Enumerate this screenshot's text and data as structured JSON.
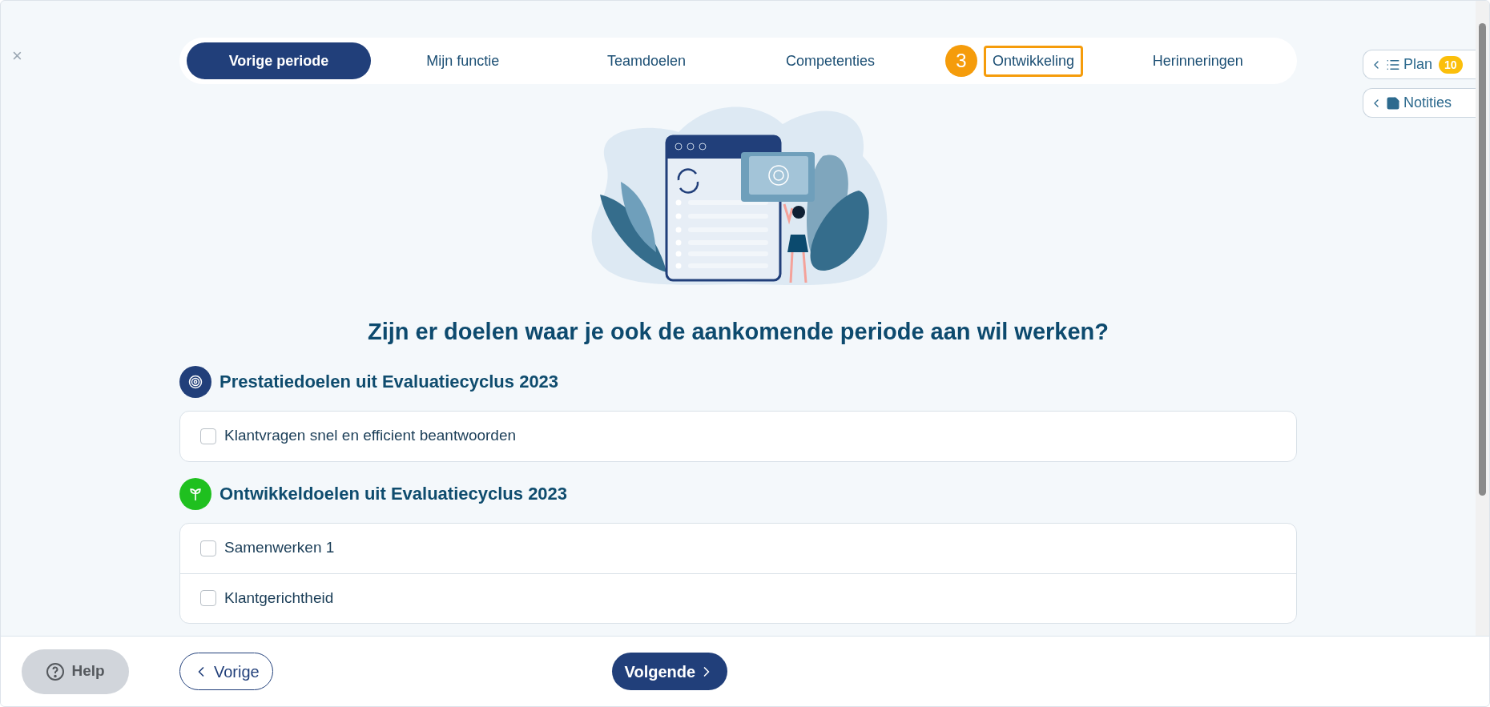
{
  "close_icon": "×",
  "tabs": [
    {
      "label": "Vorige periode",
      "selected": true,
      "highlighted": false
    },
    {
      "label": "Mijn functie",
      "selected": false,
      "highlighted": false
    },
    {
      "label": "Teamdoelen",
      "selected": false,
      "highlighted": false
    },
    {
      "label": "Competenties",
      "selected": false,
      "highlighted": false
    },
    {
      "label": "Ontwikkeling",
      "selected": false,
      "highlighted": true
    },
    {
      "label": "Herinneringen",
      "selected": false,
      "highlighted": false
    }
  ],
  "tour_step": "3",
  "side_buttons": [
    {
      "kind": "plan",
      "label": "Plan",
      "badge": "10"
    },
    {
      "kind": "notes",
      "label": "Notities"
    }
  ],
  "question": "Zijn er doelen waar je ook de aankomende periode aan wil werken?",
  "sections": [
    {
      "kind": "performance",
      "title": "Prestatiedoelen uit Evaluatiecyclus 2023",
      "color": "#213f7a",
      "items": [
        {
          "label": "Klantvragen snel en efficient beantwoorden",
          "checked": false
        }
      ]
    },
    {
      "kind": "development",
      "title": "Ontwikkeldoelen uit Evaluatiecyclus 2023",
      "color": "#1fc01f",
      "items": [
        {
          "label": "Samenwerken 1",
          "checked": false
        },
        {
          "label": "Klantgerichtheid",
          "checked": false
        }
      ]
    }
  ],
  "footer": {
    "help": "Help",
    "previous": "Vorige",
    "next": "Volgende"
  }
}
